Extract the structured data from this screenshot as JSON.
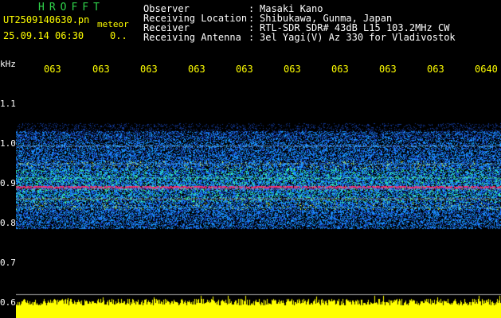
{
  "header": {
    "app_title": "HROFFT",
    "file_name": "UT2509140630.pn",
    "sub_label": "meteor",
    "datetime": "25.09.14 06:30",
    "count": "0.."
  },
  "info": [
    {
      "label": "Observer",
      "value": "Masaki Kano"
    },
    {
      "label": "Receiving Location",
      "value": "Shibukawa, Gunma, Japan"
    },
    {
      "label": "Receiver",
      "value": "RTL-SDR SDR# 43dB L15 103.2MHz CW"
    },
    {
      "label": "Receiving Antenna",
      "value": "3el Yagi(V) Az 330 for Vladivostok"
    }
  ],
  "info_separator": ":",
  "y_axis": {
    "unit": "kHz",
    "ticks": [
      "1.1",
      "1.0",
      "0.9",
      "0.8",
      "0.7",
      "0.6"
    ]
  },
  "time_ticks": [
    "063",
    "063",
    "063",
    "063",
    "063",
    "063",
    "063",
    "063",
    "063",
    "0640"
  ],
  "colors": {
    "title": "#2fd24a",
    "ticks": "#ffff00",
    "labels": "#ffffff",
    "signal_line": "#ff2060",
    "noise_bar": "#ffff00",
    "background": "#000000"
  }
}
